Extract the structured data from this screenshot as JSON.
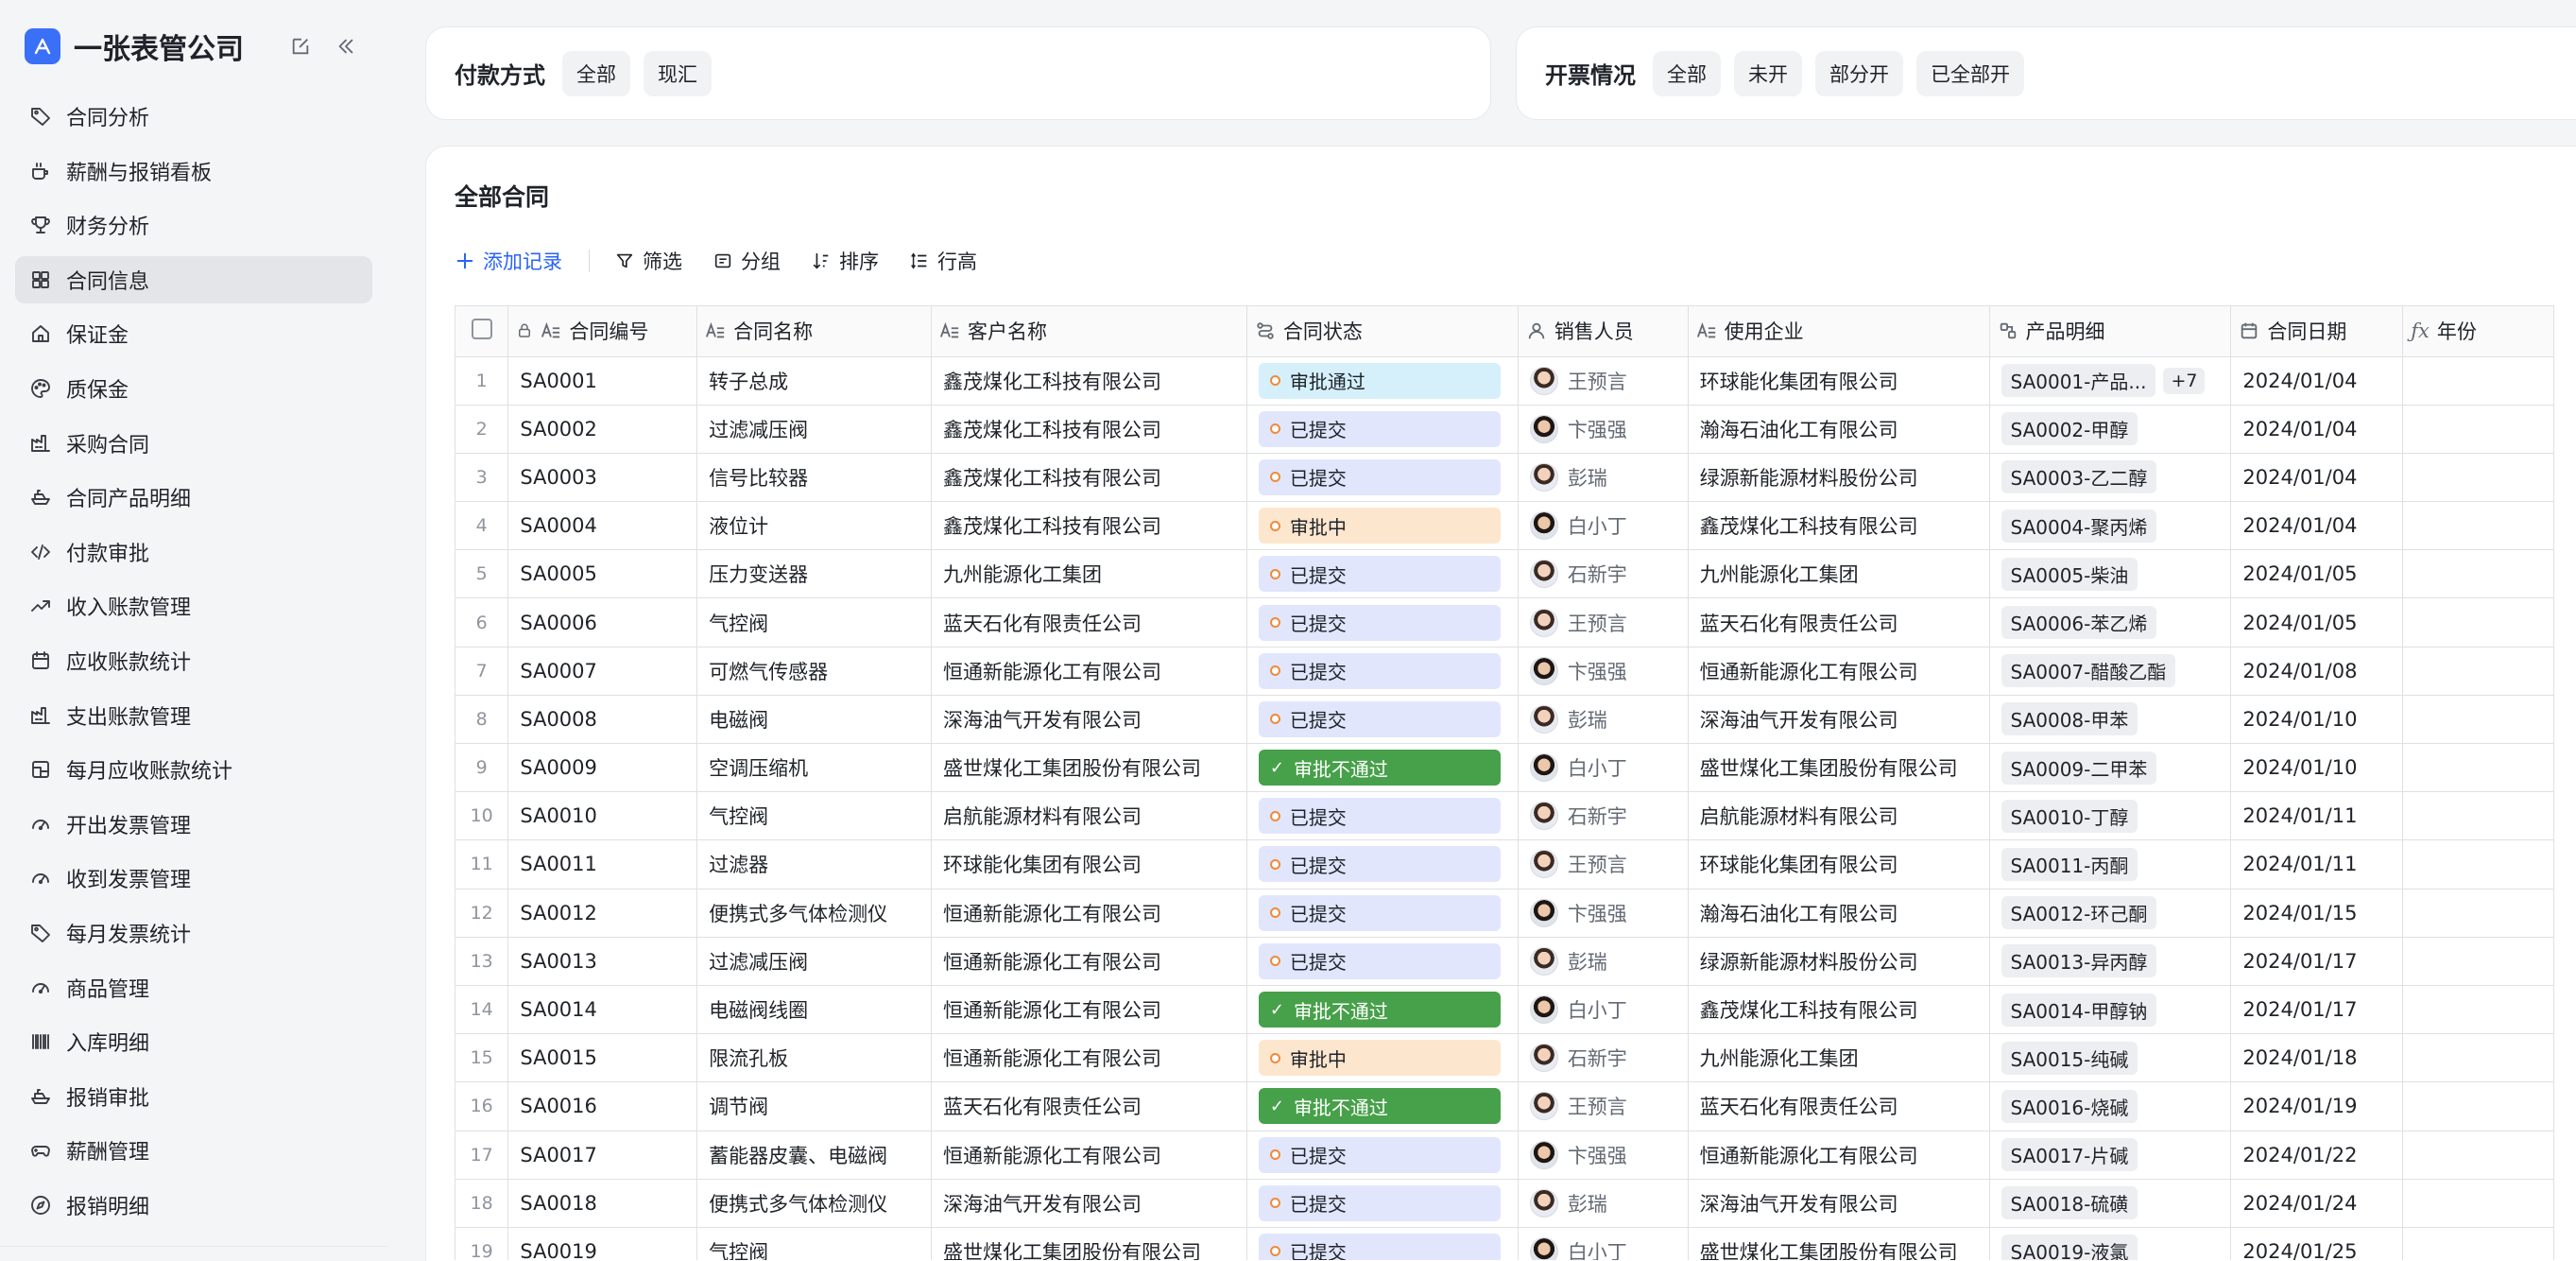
{
  "app": {
    "title": "一张表管公司"
  },
  "sidebar": {
    "items": [
      {
        "label": "合同分析",
        "icon": "tag-icon"
      },
      {
        "label": "薪酬与报销看板",
        "icon": "cup-icon"
      },
      {
        "label": "财务分析",
        "icon": "trophy-icon"
      },
      {
        "label": "合同信息",
        "icon": "grid-icon",
        "active": true
      },
      {
        "label": "保证金",
        "icon": "home-icon"
      },
      {
        "label": "质保金",
        "icon": "palette-icon"
      },
      {
        "label": "采购合同",
        "icon": "factory-icon"
      },
      {
        "label": "合同产品明细",
        "icon": "boat-icon"
      },
      {
        "label": "付款审批",
        "icon": "code-icon"
      },
      {
        "label": "收入账款管理",
        "icon": "trend-up-icon"
      },
      {
        "label": "应收账款统计",
        "icon": "calendar-icon"
      },
      {
        "label": "支出账款管理",
        "icon": "factory-icon"
      },
      {
        "label": "每月应收账款统计",
        "icon": "layout-icon"
      },
      {
        "label": "开出发票管理",
        "icon": "gauge-icon"
      },
      {
        "label": "收到发票管理",
        "icon": "gauge-icon"
      },
      {
        "label": "每月发票统计",
        "icon": "tag-icon"
      },
      {
        "label": "商品管理",
        "icon": "gauge-icon"
      },
      {
        "label": "入库明细",
        "icon": "barcode-icon"
      },
      {
        "label": "报销审批",
        "icon": "boat-icon"
      },
      {
        "label": "薪酬管理",
        "icon": "gamepad-icon"
      },
      {
        "label": "报销明细",
        "icon": "compass-icon"
      }
    ]
  },
  "filters": {
    "payment": {
      "label": "付款方式",
      "options": [
        "全部",
        "现汇"
      ]
    },
    "invoice": {
      "label": "开票情况",
      "options": [
        "全部",
        "未开",
        "部分开",
        "已全部开"
      ]
    }
  },
  "main": {
    "title": "全部合同",
    "toolbar": {
      "add": "添加记录",
      "filter": "筛选",
      "group": "分组",
      "sort": "排序",
      "row_height": "行高"
    },
    "columns": [
      "合同编号",
      "合同名称",
      "客户名称",
      "合同状态",
      "销售人员",
      "使用企业",
      "产品明细",
      "合同日期",
      "年份"
    ],
    "rows": [
      {
        "n": "1",
        "id": "SA0001",
        "name": "转子总成",
        "customer": "鑫茂煤化工科技有限公司",
        "status": "审批通过",
        "status_type": "pass",
        "sales": "王预言",
        "avatar": "f",
        "company": "环球能化集团有限公司",
        "product": "SA0001-产品...",
        "more": "+7",
        "date": "2024/01/04"
      },
      {
        "n": "2",
        "id": "SA0002",
        "name": "过滤减压阀",
        "customer": "鑫茂煤化工科技有限公司",
        "status": "已提交",
        "status_type": "sub",
        "sales": "卞强强",
        "avatar": "b",
        "company": "瀚海石油化工有限公司",
        "product": "SA0002-甲醇",
        "date": "2024/01/04"
      },
      {
        "n": "3",
        "id": "SA0003",
        "name": "信号比较器",
        "customer": "鑫茂煤化工科技有限公司",
        "status": "已提交",
        "status_type": "sub",
        "sales": "彭瑞",
        "avatar": "f",
        "company": "绿源新能源材料股份公司",
        "product": "SA0003-乙二醇",
        "date": "2024/01/04"
      },
      {
        "n": "4",
        "id": "SA0004",
        "name": "液位计",
        "customer": "鑫茂煤化工科技有限公司",
        "status": "审批中",
        "status_type": "ing",
        "sales": "白小丁",
        "avatar": "b",
        "company": "鑫茂煤化工科技有限公司",
        "product": "SA0004-聚丙烯",
        "date": "2024/01/04"
      },
      {
        "n": "5",
        "id": "SA0005",
        "name": "压力变送器",
        "customer": "九州能源化工集团",
        "status": "已提交",
        "status_type": "sub",
        "sales": "石新宇",
        "avatar": "f",
        "company": "九州能源化工集团",
        "product": "SA0005-柴油",
        "date": "2024/01/05"
      },
      {
        "n": "6",
        "id": "SA0006",
        "name": "气控阀",
        "customer": "蓝天石化有限责任公司",
        "status": "已提交",
        "status_type": "sub",
        "sales": "王预言",
        "avatar": "f",
        "company": "蓝天石化有限责任公司",
        "product": "SA0006-苯乙烯",
        "date": "2024/01/05"
      },
      {
        "n": "7",
        "id": "SA0007",
        "name": "可燃气传感器",
        "customer": "恒通新能源化工有限公司",
        "status": "已提交",
        "status_type": "sub",
        "sales": "卞强强",
        "avatar": "b",
        "company": "恒通新能源化工有限公司",
        "product": "SA0007-醋酸乙酯",
        "date": "2024/01/08"
      },
      {
        "n": "8",
        "id": "SA0008",
        "name": "电磁阀",
        "customer": "深海油气开发有限公司",
        "status": "已提交",
        "status_type": "sub",
        "sales": "彭瑞",
        "avatar": "f",
        "company": "深海油气开发有限公司",
        "product": "SA0008-甲苯",
        "date": "2024/01/10"
      },
      {
        "n": "9",
        "id": "SA0009",
        "name": "空调压缩机",
        "customer": "盛世煤化工集团股份有限公司",
        "status": "审批不通过",
        "status_type": "rej",
        "sales": "白小丁",
        "avatar": "b",
        "company": "盛世煤化工集团股份有限公司",
        "product": "SA0009-二甲苯",
        "date": "2024/01/10"
      },
      {
        "n": "10",
        "id": "SA0010",
        "name": "气控阀",
        "customer": "启航能源材料有限公司",
        "status": "已提交",
        "status_type": "sub",
        "sales": "石新宇",
        "avatar": "f",
        "company": "启航能源材料有限公司",
        "product": "SA0010-丁醇",
        "date": "2024/01/11"
      },
      {
        "n": "11",
        "id": "SA0011",
        "name": "过滤器",
        "customer": "环球能化集团有限公司",
        "status": "已提交",
        "status_type": "sub",
        "sales": "王预言",
        "avatar": "f",
        "company": "环球能化集团有限公司",
        "product": "SA0011-丙酮",
        "date": "2024/01/11"
      },
      {
        "n": "12",
        "id": "SA0012",
        "name": "便携式多气体检测仪",
        "customer": "恒通新能源化工有限公司",
        "status": "已提交",
        "status_type": "sub",
        "sales": "卞强强",
        "avatar": "b",
        "company": "瀚海石油化工有限公司",
        "product": "SA0012-环己酮",
        "date": "2024/01/15"
      },
      {
        "n": "13",
        "id": "SA0013",
        "name": "过滤减压阀",
        "customer": "恒通新能源化工有限公司",
        "status": "已提交",
        "status_type": "sub",
        "sales": "彭瑞",
        "avatar": "f",
        "company": "绿源新能源材料股份公司",
        "product": "SA0013-异丙醇",
        "date": "2024/01/17"
      },
      {
        "n": "14",
        "id": "SA0014",
        "name": "电磁阀线圈",
        "customer": "恒通新能源化工有限公司",
        "status": "审批不通过",
        "status_type": "rej",
        "sales": "白小丁",
        "avatar": "b",
        "company": "鑫茂煤化工科技有限公司",
        "product": "SA0014-甲醇钠",
        "date": "2024/01/17"
      },
      {
        "n": "15",
        "id": "SA0015",
        "name": "限流孔板",
        "customer": "恒通新能源化工有限公司",
        "status": "审批中",
        "status_type": "ing",
        "sales": "石新宇",
        "avatar": "f",
        "company": "九州能源化工集团",
        "product": "SA0015-纯碱",
        "date": "2024/01/18"
      },
      {
        "n": "16",
        "id": "SA0016",
        "name": "调节阀",
        "customer": "蓝天石化有限责任公司",
        "status": "审批不通过",
        "status_type": "rej",
        "sales": "王预言",
        "avatar": "f",
        "company": "蓝天石化有限责任公司",
        "product": "SA0016-烧碱",
        "date": "2024/01/19"
      },
      {
        "n": "17",
        "id": "SA0017",
        "name": "蓄能器皮囊、电磁阀",
        "customer": "恒通新能源化工有限公司",
        "status": "已提交",
        "status_type": "sub",
        "sales": "卞强强",
        "avatar": "b",
        "company": "恒通新能源化工有限公司",
        "product": "SA0017-片碱",
        "date": "2024/01/22"
      },
      {
        "n": "18",
        "id": "SA0018",
        "name": "便携式多气体检测仪",
        "customer": "深海油气开发有限公司",
        "status": "已提交",
        "status_type": "sub",
        "sales": "彭瑞",
        "avatar": "f",
        "company": "深海油气开发有限公司",
        "product": "SA0018-硫磺",
        "date": "2024/01/24"
      },
      {
        "n": "19",
        "id": "SA0019",
        "name": "气控阀",
        "customer": "盛世煤化工集团股份有限公司",
        "status": "已提交",
        "status_type": "sub",
        "sales": "白小丁",
        "avatar": "b",
        "company": "盛世煤化工集团股份有限公司",
        "product": "SA0019-液氯",
        "date": "2024/01/25"
      }
    ]
  },
  "colors": {
    "accent": "#2a63f6",
    "logo": "#3a6ff7",
    "status_pass_bg": "#d5f0fb",
    "status_submitted_bg": "#e1e6fd",
    "status_pending_bg": "#fde6ce",
    "status_rejected_bg": "#47a04a"
  }
}
